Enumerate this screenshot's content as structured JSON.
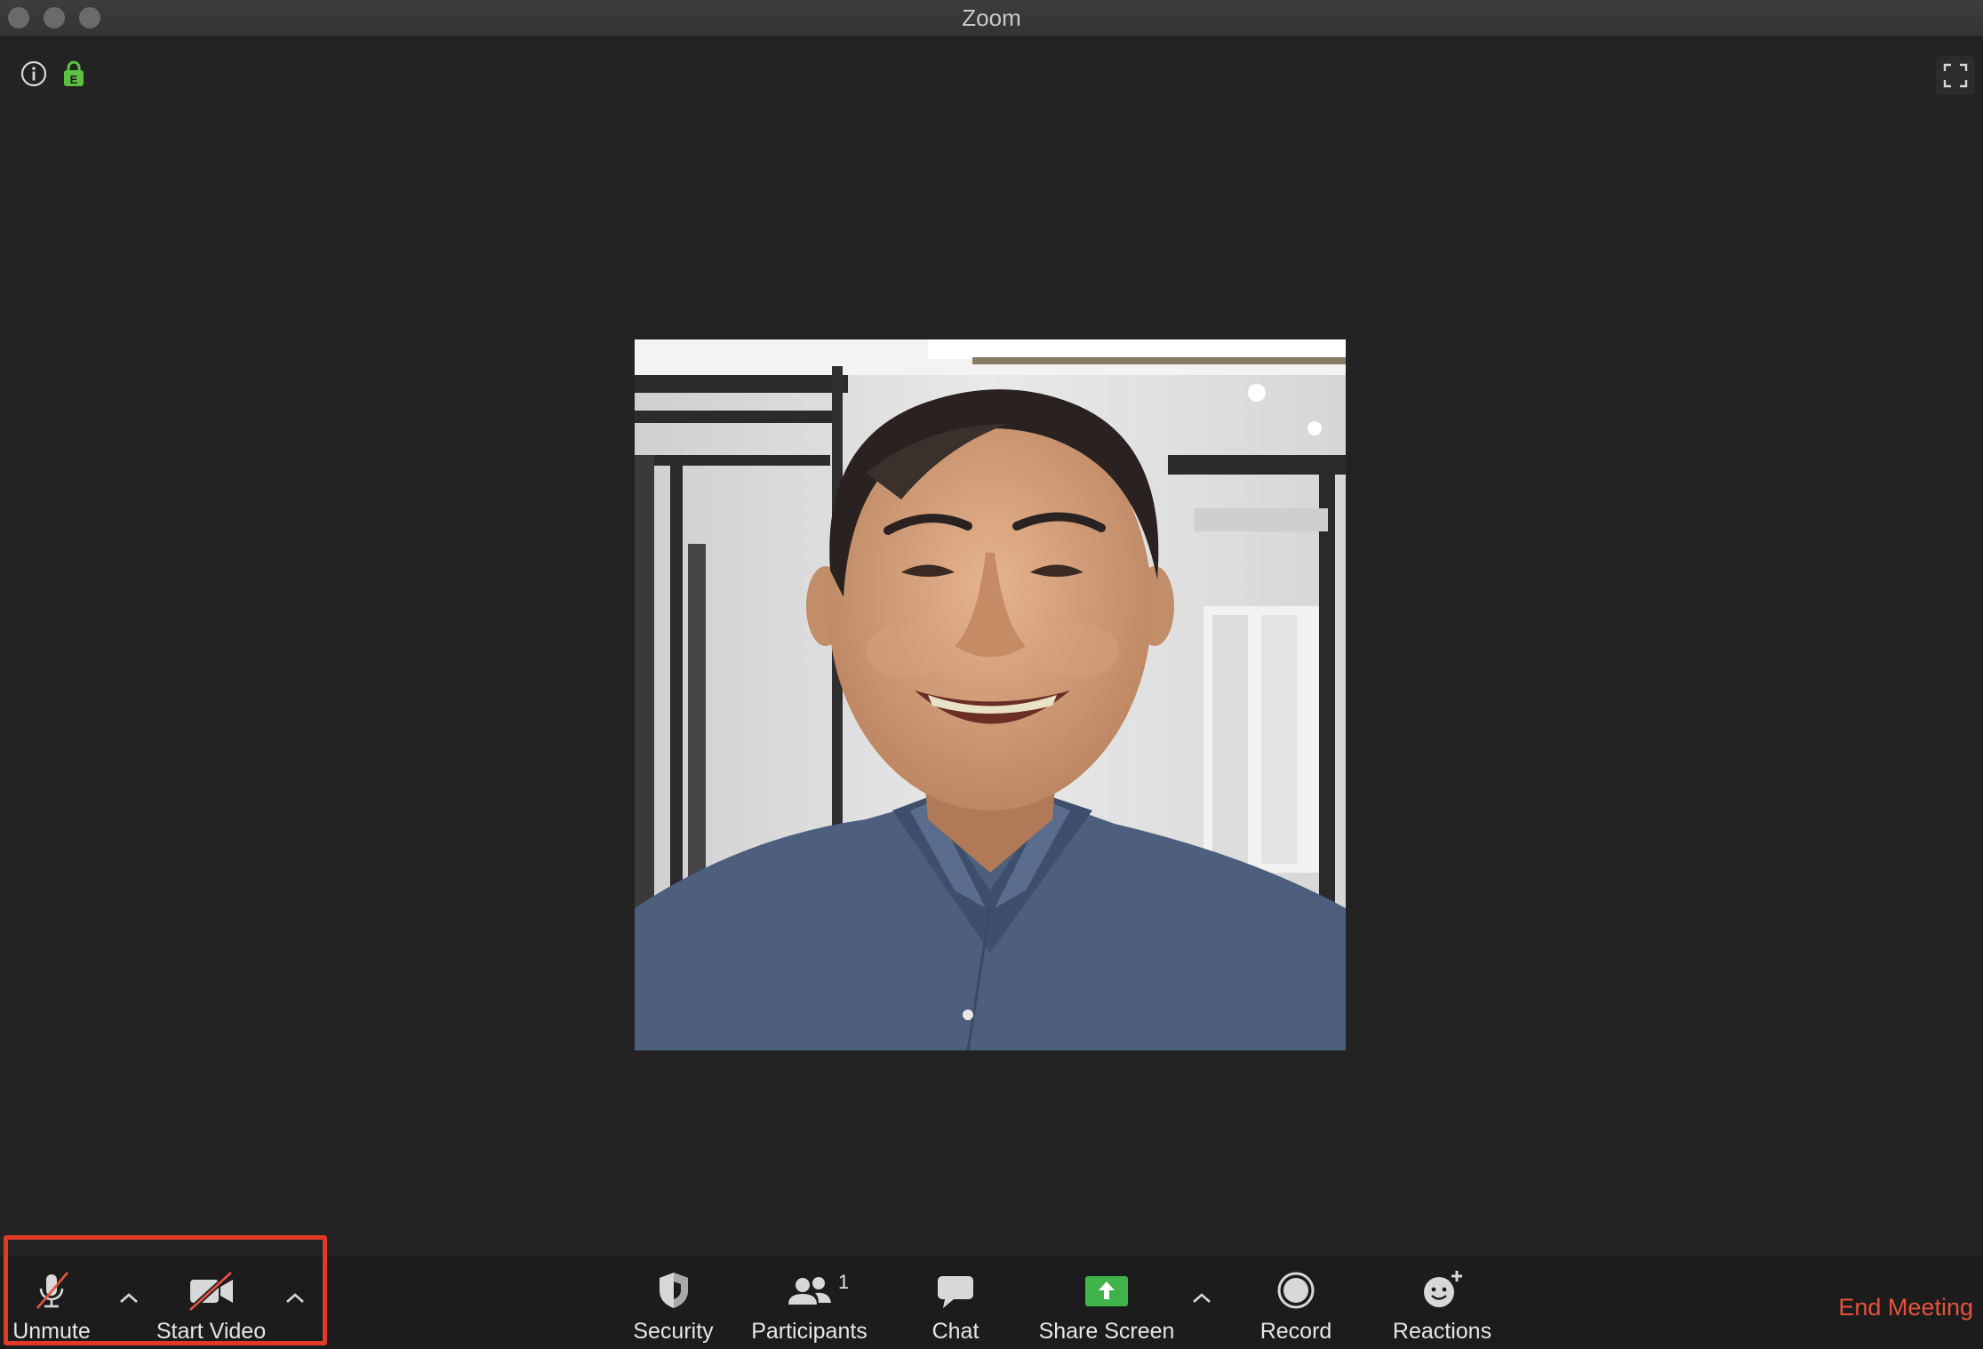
{
  "window": {
    "title": "Zoom"
  },
  "top_icons": {
    "info": "info-icon",
    "encryption": "lock-icon",
    "fullscreen": "fullscreen-icon"
  },
  "video": {
    "participant_photo": "participant-photo"
  },
  "toolbar": {
    "unmute_label": "Unmute",
    "start_video_label": "Start Video",
    "security_label": "Security",
    "participants_label": "Participants",
    "participants_count": "1",
    "chat_label": "Chat",
    "share_screen_label": "Share Screen",
    "record_label": "Record",
    "reactions_label": "Reactions",
    "end_meeting_label": "End Meeting"
  },
  "colors": {
    "background": "#232323",
    "toolbar": "#1c1c1c",
    "share_green": "#3fb24a",
    "end_meeting_red": "#e5533c",
    "highlight_red": "#e03a26",
    "lock_green": "#5cc043"
  }
}
